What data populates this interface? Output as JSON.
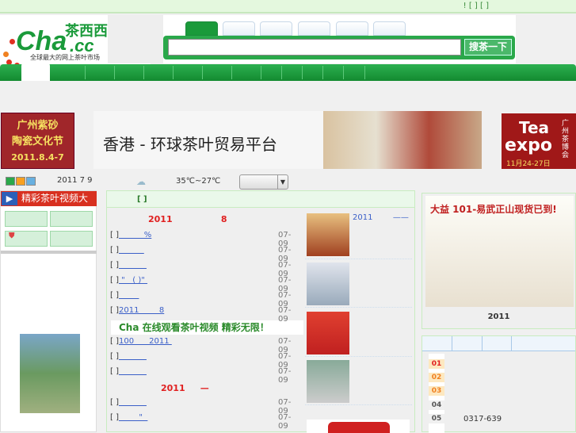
{
  "topbar": {
    "links": "! [ ] [ ]"
  },
  "logo": {
    "main": "Cha",
    "suffix": ".cc",
    "cn": "茶西西",
    "slogan": "全球最大的网上茶叶市场"
  },
  "search": {
    "value": "",
    "button": "搜茶一下"
  },
  "ads": {
    "left": [
      "广州紫砂",
      "陶瓷文化节",
      "2011.8.4-7"
    ],
    "center": "香港 - 环球茶叶贸易平台",
    "right": [
      "Tea",
      "expo",
      "广州茶博会",
      "11月24-27日"
    ]
  },
  "info": {
    "date": "2011 7 9",
    "temp": "35℃~27℃"
  },
  "left": {
    "video_title": "精彩茶叶视频大全"
  },
  "main": {
    "header": "[ ]",
    "headline1": "2011                8",
    "rows1": [
      {
        "b": "[ ]",
        "t": "          %",
        "d": "07-09"
      },
      {
        "b": "[ ]",
        "t": "          ",
        "d": "07-09"
      },
      {
        "b": "[ ]",
        "t": "           ",
        "d": "07-09"
      },
      {
        "b": "[ ]",
        "t": " \"   ( )\" ",
        "d": "07-09"
      },
      {
        "b": "[ ]",
        "t": "        ",
        "d": "07-09"
      },
      {
        "b": "[ ]",
        "t": "2011        8",
        "d": "07-09"
      }
    ],
    "banner": "Cha   在线观看茶叶视频   精彩无限！",
    "rows2": [
      {
        "b": "[ ]",
        "t": "100      2011 ",
        "d": "07-09"
      },
      {
        "b": "[ ]",
        "t": "           ",
        "d": "07-09"
      },
      {
        "b": "[ ]",
        "t": "           ",
        "d": "07-09"
      }
    ],
    "headline2": "2011     —",
    "rows3": [
      {
        "b": "[ ]",
        "t": "           ",
        "d": "07-09"
      },
      {
        "b": "[ ]",
        "t": "        \"  ",
        "d": "07-09"
      }
    ],
    "side_caption": "2011        ——"
  },
  "right": {
    "ad_text": "大益 101-易武正山现货已到!",
    "caption": "2011",
    "nums": [
      "01",
      "02",
      "03",
      "04",
      "05"
    ],
    "phone": "0317-639"
  }
}
